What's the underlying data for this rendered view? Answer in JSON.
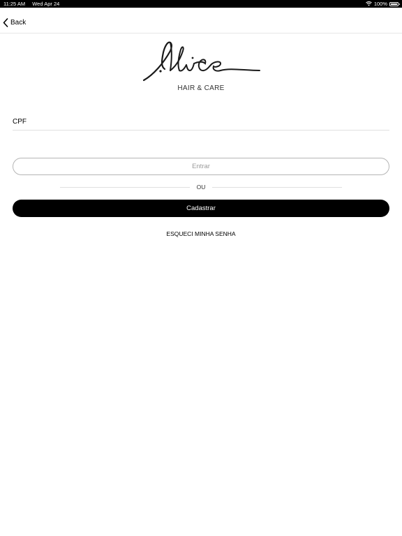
{
  "status_bar": {
    "time": "11:25 AM",
    "date": "Wed Apr 24",
    "battery_percent": "100%"
  },
  "nav": {
    "back_label": "Back"
  },
  "brand": {
    "subtitle": "HAIR & CARE"
  },
  "form": {
    "cpf_label": "CPF",
    "cpf_value": "",
    "entrar_label": "Entrar",
    "or_label": "OU",
    "cadastrar_label": "Cadastrar",
    "forgot_label": "ESQUECI MINHA SENHA"
  },
  "colors": {
    "primary_button_bg": "#000000",
    "secondary_button_border": "#b5b5b5",
    "secondary_button_text": "#9a9a9a"
  }
}
